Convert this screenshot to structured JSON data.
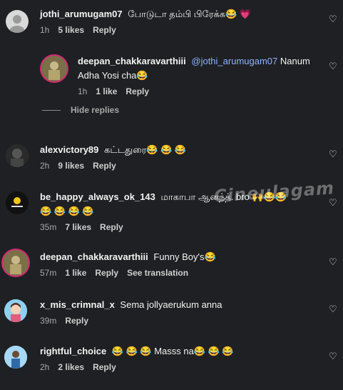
{
  "comments": [
    {
      "user": "jothi_arumugam07",
      "text": "போடுடா தம்பி பிரேக்க😂 💗",
      "time": "1h",
      "likes": "5 likes",
      "reply": "Reply"
    },
    {
      "user": "deepan_chakkaravarthiii",
      "mention": "@jothi_arumugam07",
      "text": "Nanum",
      "text2": "Adha Yosi cha😂",
      "time": "1h",
      "likes": "1 like",
      "reply": "Reply"
    },
    {
      "user": "alexvictory89",
      "text": "கட்டதுரை😂 😂 😂",
      "time": "2h",
      "likes": "9 likes",
      "reply": "Reply"
    },
    {
      "user": "be_happy_always_ok_143",
      "text": "மாகாபா ஆனந்த். bro 🙌😂😂",
      "text2": "😂 😂 😂 😂",
      "time": "35m",
      "likes": "7 likes",
      "reply": "Reply"
    },
    {
      "user": "deepan_chakkaravarthiii",
      "text": "Funny Boy's😂",
      "time": "57m",
      "likes": "1 like",
      "reply": "Reply",
      "translation": "See translation"
    },
    {
      "user": "x_mis_crimnal_x",
      "text": "Sema jollyaerukum anna",
      "time": "39m",
      "reply": "Reply"
    },
    {
      "user": "rightful_choice",
      "text": "😂 😂 😂 Masss na😂 😂 😂",
      "time": "2h",
      "likes": "2 likes",
      "reply": "Reply"
    }
  ],
  "hide_replies": "Hide replies",
  "watermark": "Cineulagam",
  "colors": {
    "background": "#1f2023",
    "mention": "#8fb3ff",
    "heart_pink": "#ff4fa0"
  }
}
